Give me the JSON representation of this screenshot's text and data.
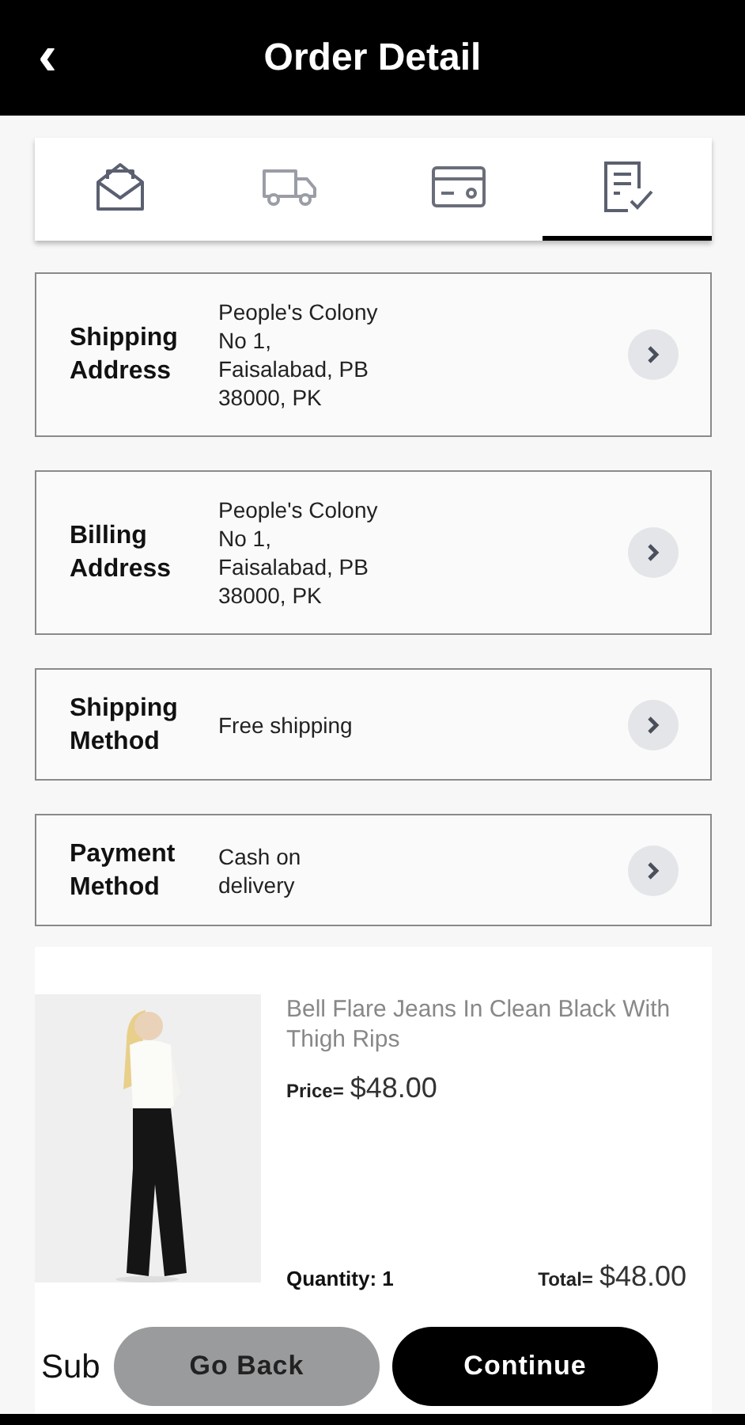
{
  "header": {
    "back_icon": "‹",
    "title": "Order Detail"
  },
  "tabs": [
    {
      "kind": "envelope",
      "selected": false
    },
    {
      "kind": "truck",
      "selected": false
    },
    {
      "kind": "card",
      "selected": false
    },
    {
      "kind": "checklist",
      "selected": true
    }
  ],
  "sections": [
    {
      "label": "Shipping Address",
      "value": [
        "People's Colony",
        "No 1,",
        "Faisalabad, PB",
        "38000, PK"
      ]
    },
    {
      "label": "Billing Address",
      "value": [
        "People's Colony",
        "No 1,",
        "Faisalabad, PB",
        "38000, PK"
      ]
    },
    {
      "label": "Shipping Method",
      "value": [
        "Free shipping"
      ]
    },
    {
      "label": "Payment Method",
      "value": [
        "Cash on",
        "delivery"
      ]
    }
  ],
  "product": {
    "kind": "picture",
    "name": "Bell Flare Jeans In Clean Black With Thigh Rips",
    "price_label": "Price=",
    "price": "$48.00",
    "quantity": "Quantity: 1",
    "total_label": "Total=",
    "total": "$48.00"
  },
  "subtotal_label": "Sub",
  "buttons": [
    {
      "kind": "secondary",
      "label": "Go Back"
    },
    {
      "kind": "primary",
      "label": "Continue"
    }
  ]
}
